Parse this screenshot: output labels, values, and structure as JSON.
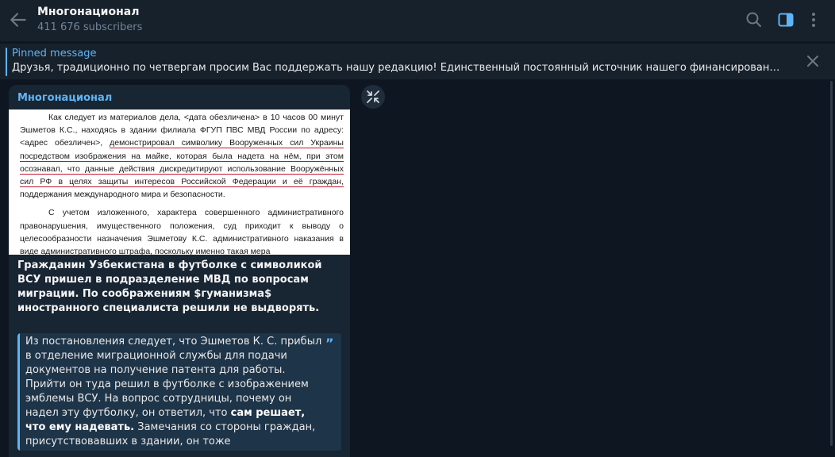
{
  "header": {
    "title": "Многонационал",
    "subtitle": "411 676 subscribers"
  },
  "pinned": {
    "label": "Pinned message",
    "text": "Друзья, традиционно по четвергам просим Вас поддержать нашу редакцию!   Единственный постоянный источник нашего финансирования — это Ва..."
  },
  "message": {
    "author": "Многонационал",
    "document": {
      "p1_before": "Как следует из материалов дела, <дата обезличена> в 10 часов 00 минут Эшметов К.С., находясь в здании филиала ФГУП ПВС МВД России по адресу: <адрес обезличен>, ",
      "p1_underlined": "демонстрировал символику Вооруженных сил Украины посредством изображения на майке, которая была надета на нём, при этом осознавал, что данные действия дискредитируют использование Вооружённых сил РФ в целях защиты интересов Российской Федерации и её граждан,",
      "p1_after": " поддержания международного мира и безопасности.",
      "p2": "С учетом изложенного, характера совершенного административного правонарушения, имущественного положения, суд приходит к выводу о целесообразности назначения Эшметову К.С. административного наказания в виде административного штрафа, поскольку именно такая мера"
    },
    "caption": "Гражданин Узбекистана в футболке с символикой ВСУ пришел в подразделение МВД по вопросам миграции. По соображениям $гуманизма$ иностранного специалиста решили не выдворять.",
    "quote": {
      "part1": "Из постановления следует, что Эшметов К. С. прибыл в отделение миграционной службы для подачи документов на получение патента для работы. Прийти он туда решил в футболке с изображением эмблемы ВСУ. На вопрос сотрудницы, почему он надел эту футболку, он ответил, что ",
      "bold": "сам решает, что ему надевать.",
      "part2": " Замечания со стороны граждан, присутствовавших в здании, он тоже проигнорировал."
    }
  },
  "colors": {
    "background": "#0e1621",
    "panel": "#17212b",
    "bubble": "#182533",
    "accent": "#5eb5f7",
    "muted": "#708499",
    "underline": "#c2142f"
  },
  "icons": {
    "back": "arrow-left-icon",
    "search": "search-icon",
    "sidebar": "sidebar-toggle-icon",
    "menu": "more-vertical-icon",
    "close": "close-icon",
    "shrink": "collapse-icon",
    "quote": "quote-icon"
  }
}
